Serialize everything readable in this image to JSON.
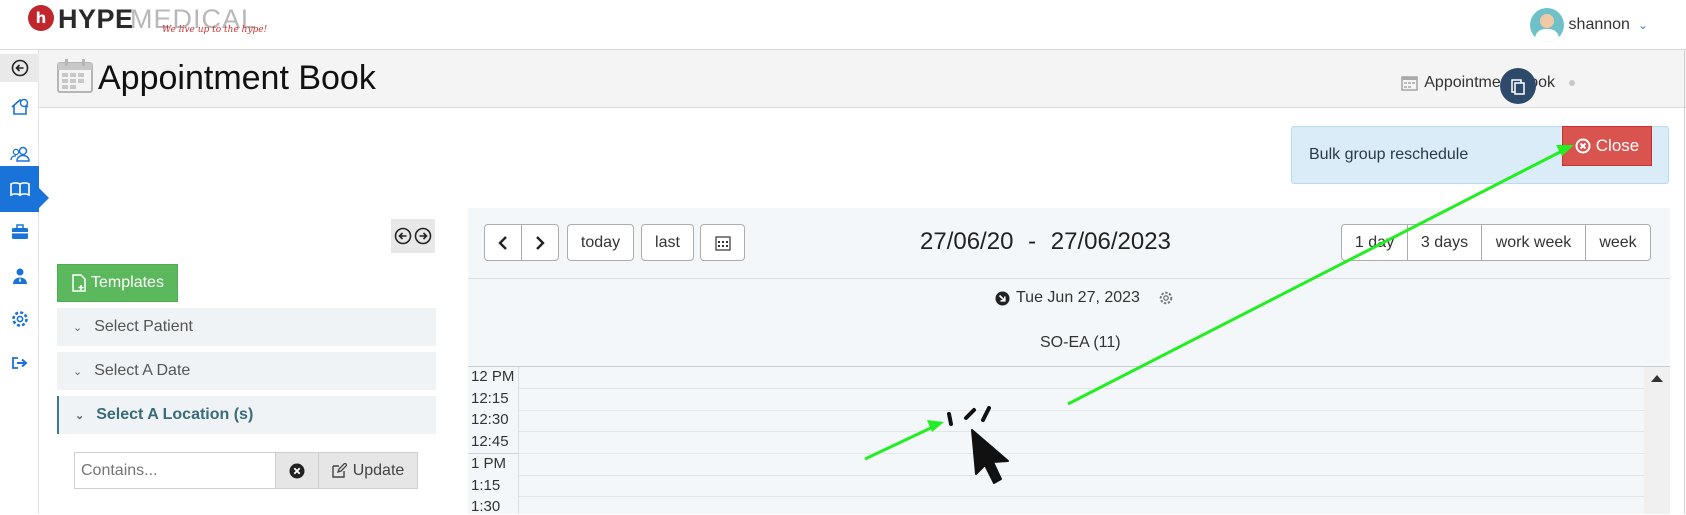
{
  "brand": {
    "name_bold": "HYPE",
    "name_light": "MEDICAL",
    "tagline": "We live up to the hype!",
    "logo_letter": "h",
    "color": "#c0272d"
  },
  "user": {
    "name": "shannon"
  },
  "sidebar": {
    "items": [
      {
        "icon": "home-icon"
      },
      {
        "icon": "users-icon"
      },
      {
        "icon": "book-icon",
        "active": true
      },
      {
        "icon": "briefcase-icon"
      },
      {
        "icon": "user-tie-icon"
      },
      {
        "icon": "gear-icon"
      },
      {
        "icon": "sign-out-icon"
      }
    ],
    "active_color": "#1a73d9"
  },
  "header": {
    "title": "Appointment Book",
    "breadcrumb": "Appointment Book"
  },
  "alert": {
    "text": "Bulk group reschedule",
    "close_label": "Close"
  },
  "left_panel": {
    "templates_label": "Templates",
    "accordion": [
      {
        "label": "Select Patient",
        "active": false
      },
      {
        "label": "Select A Date",
        "active": false
      },
      {
        "label": "Select A Location (s)",
        "active": true
      }
    ],
    "location_input": {
      "placeholder": "Contains...",
      "value": ""
    },
    "update_label": "Update"
  },
  "calendar": {
    "nav": {
      "today_label": "today",
      "last_label": "last"
    },
    "range_start": "27/06/20 -",
    "range_end": "27/06/2023",
    "views": [
      "1 day",
      "3 days",
      "work week",
      "week"
    ],
    "day_label": "Tue Jun 27, 2023",
    "resource": "SO-EA (11)",
    "slots": [
      "12 PM",
      "12:15",
      "12:30",
      "12:45",
      "1 PM",
      "1:15",
      "1:30"
    ]
  },
  "colors": {
    "close_button": "#d9534f",
    "templates_button": "#5cb85c",
    "alert_bg": "#d9ecf7",
    "annotation_arrow": "#22ee22"
  }
}
